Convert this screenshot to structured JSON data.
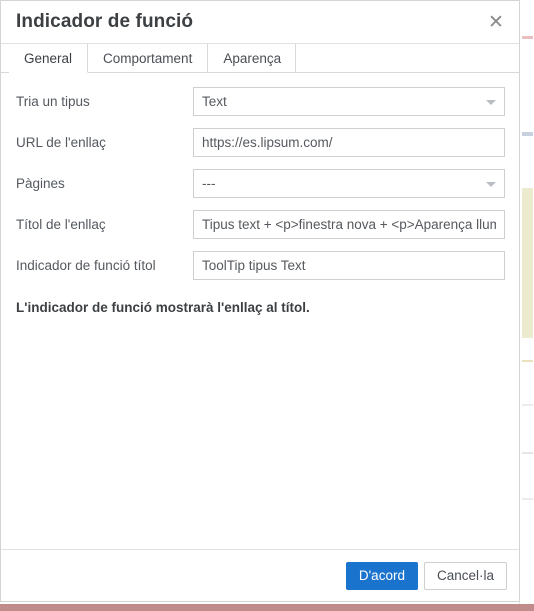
{
  "dialog": {
    "title": "Indicador de funció",
    "close_icon": "close-icon"
  },
  "tabs": [
    {
      "label": "General",
      "active": true
    },
    {
      "label": "Comportament",
      "active": false
    },
    {
      "label": "Aparença",
      "active": false
    }
  ],
  "form": {
    "fields": [
      {
        "label": "Tria un tipus",
        "type": "select",
        "value": "Text",
        "name": "type-select"
      },
      {
        "label": "URL de l'enllaç",
        "type": "text",
        "value": "https://es.lipsum.com/",
        "placeholder": "",
        "name": "link-url-input"
      },
      {
        "label": "Pàgines",
        "type": "select",
        "value": "---",
        "name": "pages-select"
      },
      {
        "label": "Títol de l'enllaç",
        "type": "text",
        "value": "Tipus text + <p>finestra nova + <p>Aparença llum",
        "placeholder": "",
        "name": "link-title-input"
      },
      {
        "label": "Indicador de funció títol",
        "type": "text",
        "value": "ToolTip tipus Text",
        "placeholder": "",
        "name": "tooltip-title-input"
      }
    ],
    "note": "L'indicador de funció mostrarà l'enllaç al títol."
  },
  "footer": {
    "ok_label": "D'acord",
    "cancel_label": "Cancel·la"
  },
  "colors": {
    "primary": "#1a73cc",
    "text": "#3c4043",
    "label": "#54595f",
    "border": "#cfcfcf",
    "bottom_bar": "#c08b8b"
  }
}
